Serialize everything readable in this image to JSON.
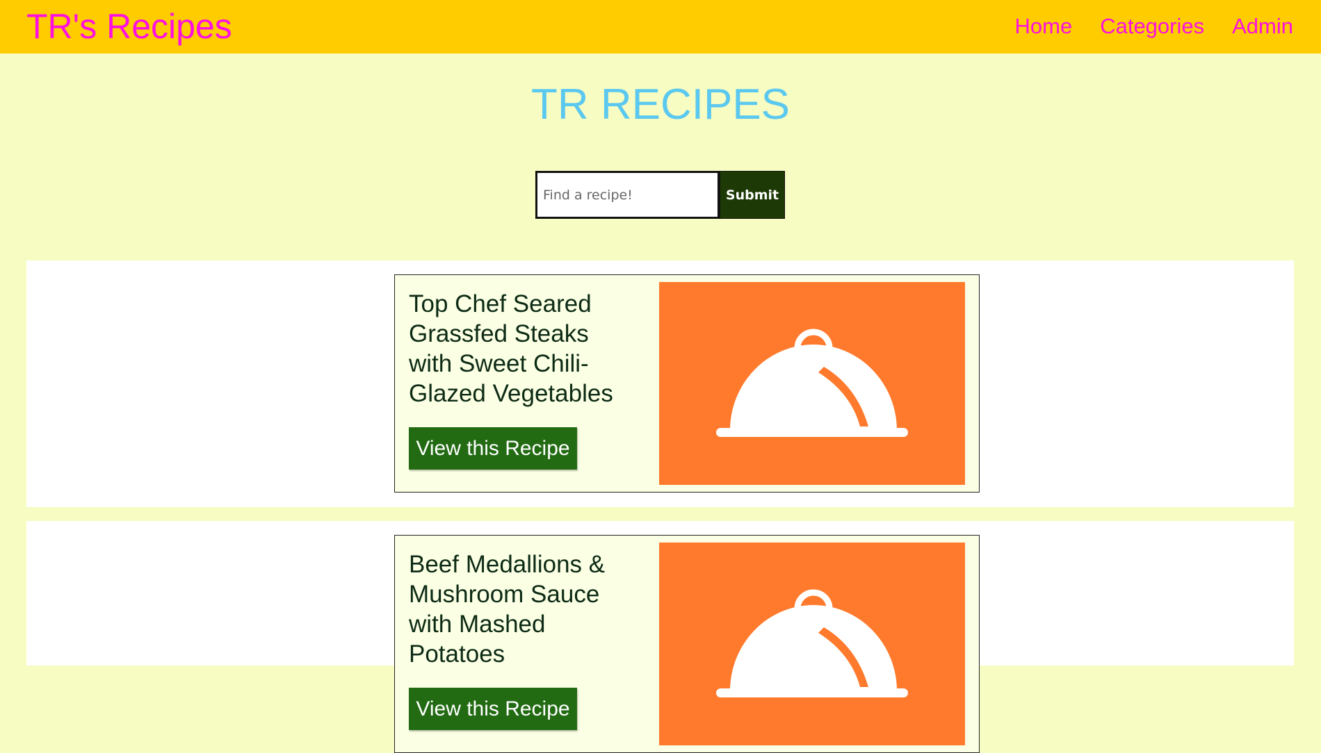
{
  "header": {
    "brand": "TR's Recipes",
    "nav": [
      {
        "label": "Home"
      },
      {
        "label": "Categories"
      },
      {
        "label": "Admin"
      }
    ],
    "bg_color": "#ffcc00",
    "link_color": "#ff10e0"
  },
  "main": {
    "title": "TR RECIPES",
    "search": {
      "placeholder": "Find a recipe!",
      "value": "",
      "submit_label": "Submit"
    }
  },
  "recipes": [
    {
      "title": "Top Chef Seared Grassfed Steaks with Sweet Chili-Glazed Vegetables",
      "button_label": "View this Recipe",
      "image_icon": "serving-cloche-icon"
    },
    {
      "title": "Beef Medallions & Mushroom Sauce with Mashed Potatoes",
      "button_label": "View this Recipe",
      "image_icon": "serving-cloche-icon"
    }
  ],
  "colors": {
    "page_bg": "#f7fcc3",
    "title": "#5bc8ef",
    "button": "#226b13",
    "image_bg": "#ff7a2c"
  }
}
